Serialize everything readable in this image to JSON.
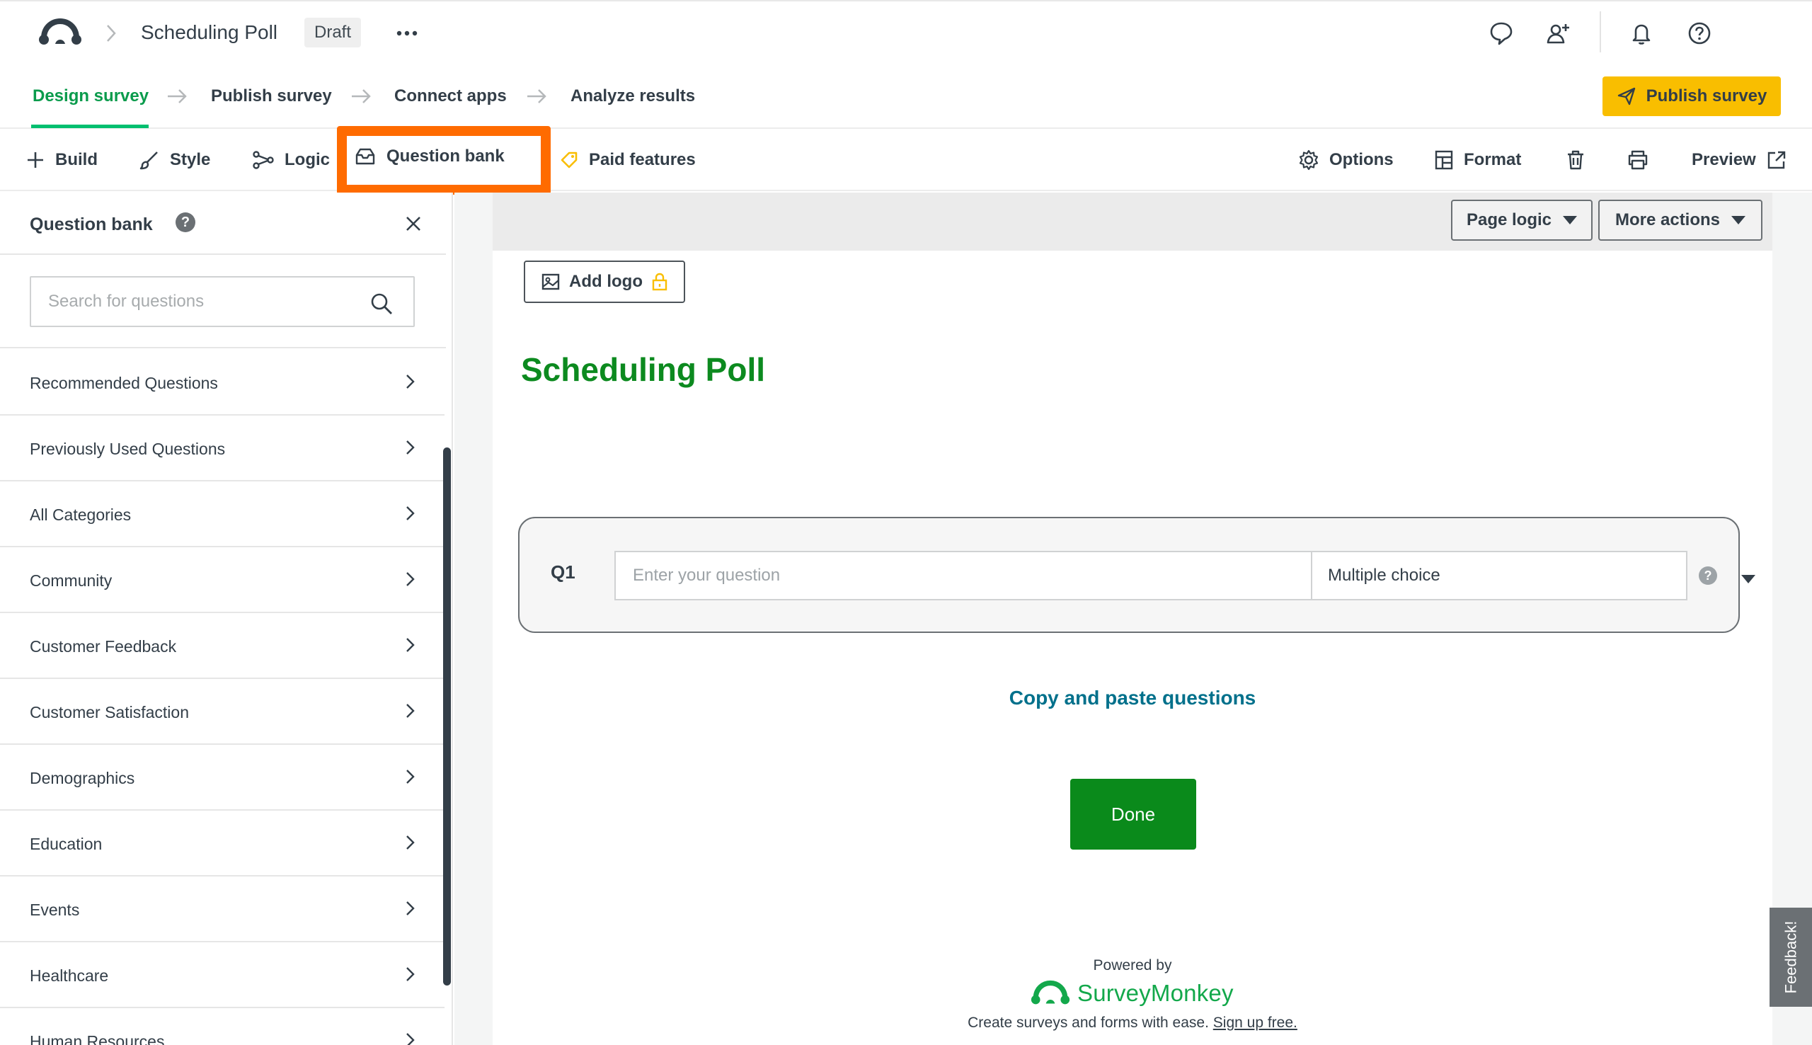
{
  "header": {
    "survey_title": "Scheduling Poll",
    "status_badge": "Draft"
  },
  "steps": [
    {
      "label": "Design survey",
      "active": true
    },
    {
      "label": "Publish survey"
    },
    {
      "label": "Connect apps"
    },
    {
      "label": "Analyze results"
    }
  ],
  "publish_button": "Publish survey",
  "toolbar": {
    "build": "Build",
    "style": "Style",
    "logic": "Logic",
    "question_bank": "Question bank",
    "paid_features": "Paid features",
    "options": "Options",
    "format": "Format",
    "preview": "Preview"
  },
  "panel": {
    "title": "Question bank",
    "help": "?",
    "search_placeholder": "Search for questions",
    "categories": [
      "Recommended Questions",
      "Previously Used Questions",
      "All Categories",
      "Community",
      "Customer Feedback",
      "Customer Satisfaction",
      "Demographics",
      "Education",
      "Events",
      "Healthcare",
      "Human Resources"
    ]
  },
  "canvas": {
    "page_logic": "Page logic",
    "more_actions": "More actions",
    "add_logo": "Add logo",
    "survey_title": "Scheduling Poll",
    "question": {
      "number": "Q1",
      "placeholder": "Enter your question",
      "type": "Multiple choice",
      "help": "?"
    },
    "copy_paste_link": "Copy and paste questions",
    "done_button": "Done",
    "powered_by": "Powered by",
    "brand": "SurveyMonkey",
    "tagline": "Create surveys and forms with ease.",
    "signup_link": "Sign up free."
  },
  "feedback_tab": "Feedback!",
  "colors": {
    "accent_green": "#00bf6f",
    "title_green": "#0c8a1f",
    "publish_yellow": "#f9be00",
    "highlight_orange": "#ff6b00",
    "link_teal": "#00708b"
  },
  "icons": {
    "logo": "surveymonkey-logo-icon",
    "comment": "comment-icon",
    "add_user": "add-user-icon",
    "notifications": "bell-icon",
    "help": "help-icon"
  }
}
